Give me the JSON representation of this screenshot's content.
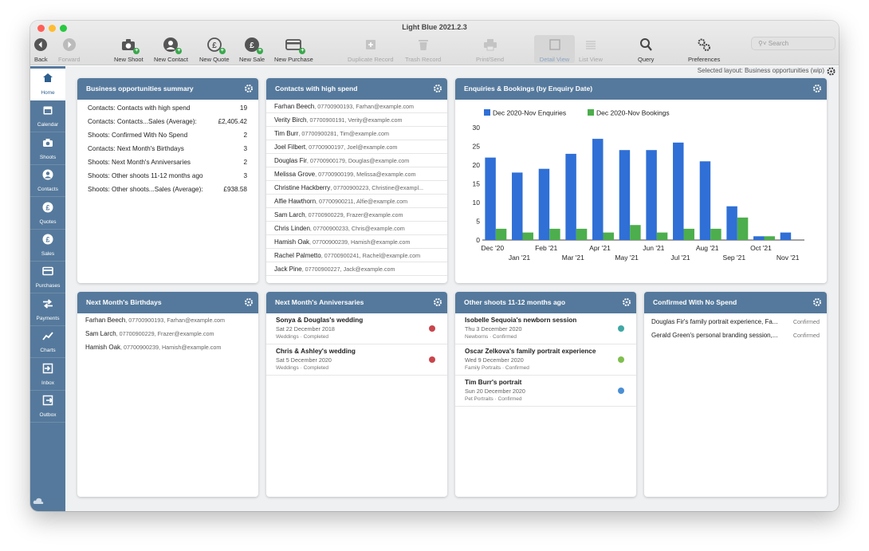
{
  "window": {
    "title": "Light Blue 2021.2.3"
  },
  "toolbar": {
    "back": "Back",
    "forward": "Forward",
    "new_shoot": "New Shoot",
    "new_contact": "New Contact",
    "new_quote": "New Quote",
    "new_sale": "New Sale",
    "new_purchase": "New Purchase",
    "duplicate_record": "Duplicate Record",
    "trash_record": "Trash Record",
    "print_send": "Print/Send",
    "detail_view": "Detail View",
    "list_view": "List View",
    "query": "Query",
    "preferences": "Preferences",
    "search_placeholder": "Search"
  },
  "sidebar": {
    "items": [
      {
        "label": "Home",
        "icon": "home-icon"
      },
      {
        "label": "Calendar",
        "icon": "calendar-icon"
      },
      {
        "label": "Shoots",
        "icon": "camera-icon"
      },
      {
        "label": "Contacts",
        "icon": "person-icon"
      },
      {
        "label": "Quotes",
        "icon": "pound-icon"
      },
      {
        "label": "Sales",
        "icon": "pound-icon"
      },
      {
        "label": "Purchases",
        "icon": "card-icon"
      },
      {
        "label": "Payments",
        "icon": "arrows-icon"
      },
      {
        "label": "Charts",
        "icon": "chart-icon"
      },
      {
        "label": "Inbox",
        "icon": "inbox-icon"
      },
      {
        "label": "Outbox",
        "icon": "outbox-icon"
      }
    ]
  },
  "layout_info": "Selected layout: Business opportunities (wip)",
  "summary": {
    "title": "Business opportunities summary",
    "rows": [
      {
        "label": "Contacts: Contacts with high spend",
        "value": "19"
      },
      {
        "label": "Contacts: Contacts...Sales (Average):",
        "value": "£2,405.42"
      },
      {
        "label": "Shoots: Confirmed With No Spend",
        "value": "2"
      },
      {
        "label": "Contacts: Next Month's Birthdays",
        "value": "3"
      },
      {
        "label": "Shoots: Next Month's Anniversaries",
        "value": "2"
      },
      {
        "label": "Shoots: Other shoots 11-12 months ago",
        "value": "3"
      },
      {
        "label": "Shoots: Other shoots...Sales (Average):",
        "value": "£938.58"
      }
    ]
  },
  "high_spend": {
    "title": "Contacts with high spend",
    "rows": [
      {
        "name": "Farhan Beech",
        "detail": ", 07700900193, Farhan@example.com"
      },
      {
        "name": "Verity Birch",
        "detail": ", 07700900191, Verity@example.com"
      },
      {
        "name": "Tim Burr",
        "detail": ", 07700900281, Tim@example.com"
      },
      {
        "name": "Joel Filbert",
        "detail": ", 07700900197, Joel@example.com"
      },
      {
        "name": "Douglas Fir",
        "detail": ", 07700900179, Douglas@example.com"
      },
      {
        "name": "Melissa Grove",
        "detail": ", 07700900199, Melissa@example.com"
      },
      {
        "name": "Christine Hackberry",
        "detail": ", 07700900223, Christine@exampl..."
      },
      {
        "name": "Alfie Hawthorn",
        "detail": ", 07700900211, Alfie@example.com"
      },
      {
        "name": "Sam Larch",
        "detail": ", 07700900229, Frazer@example.com"
      },
      {
        "name": "Chris Linden",
        "detail": ", 07700900233, Chris@example.com"
      },
      {
        "name": "Hamish Oak",
        "detail": ", 07700900239, Hamish@example.com"
      },
      {
        "name": "Rachel Palmetto",
        "detail": ", 07700900241, Rachel@example.com"
      },
      {
        "name": "Jack Pine",
        "detail": ", 07700900227, Jack@example.com"
      }
    ]
  },
  "enquiries": {
    "title": "Enquiries & Bookings (by Enquiry Date)"
  },
  "chart_data": {
    "type": "bar",
    "categories": [
      "Dec '20",
      "Jan '21",
      "Feb '21",
      "Mar '21",
      "Apr '21",
      "May '21",
      "Jun '21",
      "Jul '21",
      "Aug '21",
      "Sep '21",
      "Oct '21",
      "Nov '21"
    ],
    "series": [
      {
        "name": "Dec 2020-Nov Enquiries",
        "color": "#2f6fd6",
        "values": [
          22,
          18,
          19,
          23,
          27,
          24,
          24,
          26,
          21,
          9,
          1,
          2
        ]
      },
      {
        "name": "Dec 2020-Nov Bookings",
        "color": "#4cae4c",
        "values": [
          3,
          2,
          3,
          3,
          2,
          4,
          2,
          3,
          3,
          6,
          1,
          0
        ]
      }
    ],
    "ylim": [
      0,
      30
    ],
    "yticks": [
      0,
      5,
      10,
      15,
      20,
      25,
      30
    ],
    "legend": "top-left",
    "grid": false
  },
  "birthdays": {
    "title": "Next Month's Birthdays",
    "rows": [
      {
        "name": "Farhan Beech",
        "detail": ", 07700900193, Farhan@example.com"
      },
      {
        "name": "Sam Larch",
        "detail": ", 07700900229, Frazer@example.com"
      },
      {
        "name": "Hamish Oak",
        "detail": ", 07700900239, Hamish@example.com"
      }
    ]
  },
  "anniversaries": {
    "title": "Next Month's Anniversaries",
    "items": [
      {
        "title": "Sonya & Douglas's wedding",
        "date": "Sat 22 December 2018",
        "category": "Weddings · Completed",
        "color": "#c9454b"
      },
      {
        "title": "Chris & Ashley's wedding",
        "date": "Sat 5 December 2020",
        "category": "Weddings · Completed",
        "color": "#c9454b"
      }
    ]
  },
  "other_shoots": {
    "title": "Other shoots 11-12 months ago",
    "items": [
      {
        "title": "Isobelle Sequoia's newborn session",
        "date": "Thu 3 December 2020",
        "category": "Newborns · Confirmed",
        "color": "#3fa8a5"
      },
      {
        "title": "Oscar Zelkova's family portrait experience",
        "date": "Wed 9 December 2020",
        "category": "Family Portraits · Confirmed",
        "color": "#7fbf4d"
      },
      {
        "title": "Tim Burr's portrait",
        "date": "Sun 20 December 2020",
        "category": "Pet Portraits · Confirmed",
        "color": "#4a8fd4"
      }
    ]
  },
  "no_spend": {
    "title": "Confirmed With No Spend",
    "rows": [
      {
        "name": "Douglas Fir's family portrait experience, Fa...",
        "status": "Confirmed"
      },
      {
        "name": "Gerald Green's personal branding session,...",
        "status": "Confirmed"
      }
    ]
  }
}
